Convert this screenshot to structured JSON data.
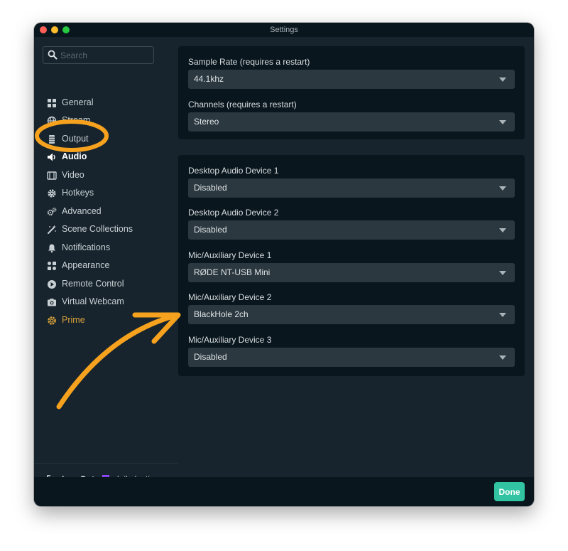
{
  "window": {
    "title": "Settings"
  },
  "sidebar": {
    "search_placeholder": "Search",
    "items": [
      {
        "label": "General",
        "icon": "grid-icon"
      },
      {
        "label": "Stream",
        "icon": "globe-icon"
      },
      {
        "label": "Output",
        "icon": "output-icon"
      },
      {
        "label": "Audio",
        "icon": "speaker-icon",
        "active": true
      },
      {
        "label": "Video",
        "icon": "film-icon"
      },
      {
        "label": "Hotkeys",
        "icon": "gear-icon"
      },
      {
        "label": "Advanced",
        "icon": "gears-icon"
      },
      {
        "label": "Scene Collections",
        "icon": "magic-wand-icon"
      },
      {
        "label": "Notifications",
        "icon": "bell-icon"
      },
      {
        "label": "Appearance",
        "icon": "shapes-icon"
      },
      {
        "label": "Remote Control",
        "icon": "play-circle-icon"
      },
      {
        "label": "Virtual Webcam",
        "icon": "camera-icon"
      },
      {
        "label": "Prime",
        "icon": "prime-icon"
      }
    ],
    "footer": {
      "logout_label": "Log Out",
      "account_name": "dailydevtips",
      "account_icon": "twitch-icon"
    }
  },
  "audio": {
    "sample_rate": {
      "label": "Sample Rate (requires a restart)",
      "value": "44.1khz"
    },
    "channels": {
      "label": "Channels (requires a restart)",
      "value": "Stereo"
    },
    "desktop_audio_1": {
      "label": "Desktop Audio Device 1",
      "value": "Disabled"
    },
    "desktop_audio_2": {
      "label": "Desktop Audio Device 2",
      "value": "Disabled"
    },
    "mic_aux_1": {
      "label": "Mic/Auxiliary Device 1",
      "value": "RØDE NT-USB Mini"
    },
    "mic_aux_2": {
      "label": "Mic/Auxiliary Device 2",
      "value": "BlackHole 2ch"
    },
    "mic_aux_3": {
      "label": "Mic/Auxiliary Device 3",
      "value": "Disabled"
    }
  },
  "footer": {
    "done_label": "Done"
  },
  "colors": {
    "window_bg": "#17242d",
    "panel_bg": "#09161d",
    "select_bg": "#2b383f",
    "accent_teal": "#31c3a2",
    "prime_gold": "#d9a13a",
    "annotation_orange": "#f6a21e",
    "twitch_purple": "#9146ff"
  }
}
